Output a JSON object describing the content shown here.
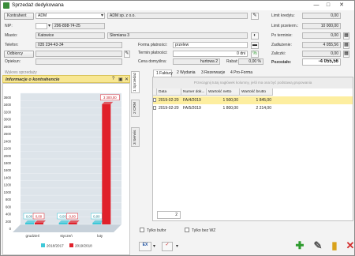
{
  "window": {
    "title": "Sprzedaż dedykowana",
    "controls": [
      "—",
      "□",
      "✕"
    ]
  },
  "header": {
    "kontrahent_button": "Kontrahent",
    "kontrahent_code": "ADM",
    "kontrahent_name": "ADM sp. z o.o.",
    "nip_label": "NIP:",
    "nip_prefix": "",
    "nip_value": "296-898-74-25",
    "miasto_label": "Miasto:",
    "miasto_value": "Katowice",
    "ulica_value": "Słomiana 3",
    "telefon_label": "Telefon:",
    "telefon_value": "035 234-43-34",
    "forma_label": "Forma płatności:",
    "forma_value": "przelew",
    "odbiorcy_button": "Odbiorcy",
    "termin_label": "Termin płatności:",
    "termin_value": "0 dni",
    "opiekun_label": "Opiekun:",
    "opiekun_value": "",
    "cena_label": "Cena domyślna:",
    "cena_value": "hurtowa 2",
    "rabat_label": "Rabat:",
    "rabat_value": "0,00 %"
  },
  "limits": {
    "limit_kredytu_label": "Limit kredytu:",
    "limit_kredytu_value": "0,00",
    "limit_przeterm_label": "Limit przeterm.:",
    "limit_przeterm_value": "10 000,00",
    "po_terminie_label": "Po terminie:",
    "po_terminie_value": "0,00",
    "zadluzenie_label": "Zadłużenie:",
    "zadluzenie_value": "4 055,56",
    "zaliczki_label": "Zaliczki:",
    "zaliczki_value": "0,00",
    "pozostalo_label": "Pozostało:",
    "pozostalo_value": "-4 055,56"
  },
  "panel": {
    "behind_header": "Wykres sprzedaży",
    "title": "Informacje o kontrahencie",
    "toolbar_icons": [
      "?",
      "▣",
      "✕"
    ]
  },
  "chart_data": {
    "type": "bar",
    "categories": [
      "grudzień",
      "styczeń",
      "luty"
    ],
    "series": [
      {
        "name": "2018/2017",
        "values": [
          0,
          0,
          0
        ],
        "labels": [
          "0,00",
          "0,00",
          "0,00"
        ],
        "color": "#3ec8d8"
      },
      {
        "name": "2019/2018",
        "values": [
          0,
          0,
          3300
        ],
        "labels": [
          "0,00",
          "0,00",
          "3 300,00"
        ],
        "color": "#e0202a"
      }
    ],
    "ylim": [
      0,
      3600
    ],
    "yticks": [
      "0",
      "200",
      "400",
      "600",
      "800",
      "1000",
      "1200",
      "1400",
      "1600",
      "1800",
      "2000",
      "2200",
      "2400",
      "2600",
      "2800",
      "3000",
      "3200",
      "3400",
      "3600"
    ],
    "grid": true,
    "legend": "bottom"
  },
  "side_tabs": [
    "1 Sprzedaż",
    "2 CRM",
    "3 Serwis"
  ],
  "tabs": [
    "1 Faktury",
    "2 Wydania",
    "3 Rezerwacje",
    "4 Pro-Forma"
  ],
  "grid": {
    "group_hint": "Przeciągnij tutaj nagłówek kolumny, jeśli ma ona być podstawą grupowania",
    "columns": [
      "Data",
      "Numer dok...",
      "Wartość netto",
      "Wartość brutto"
    ],
    "rows": [
      {
        "data": "2019-02-20",
        "numer": "FA/4/2019",
        "netto": "1 500,00",
        "brutto": "1 845,00"
      },
      {
        "data": "2019-02-20",
        "numer": "FA/5/2019",
        "netto": "1 800,00",
        "brutto": "2 214,00"
      }
    ],
    "count": "2"
  },
  "footer": {
    "tylko_bufor": "Tylko bufor",
    "tylko_bez_wz": "Tylko bez WZ"
  }
}
